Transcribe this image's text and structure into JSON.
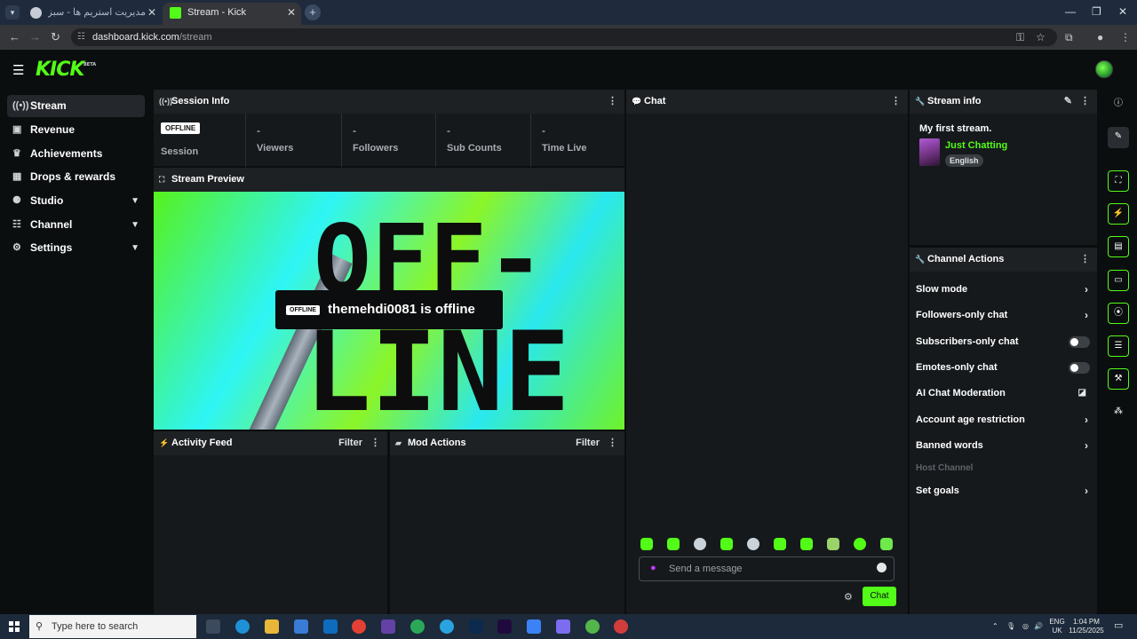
{
  "browser": {
    "tabs": [
      {
        "title": "مدیریت استریم ها - سبز استریم",
        "active": false
      },
      {
        "title": "Stream - Kick Dashboard",
        "active": true
      }
    ],
    "new_tab": "+",
    "url_host": "dashboard.kick.com",
    "url_path": "/stream"
  },
  "app": {
    "logo": "KICK",
    "logo_badge": "BETA"
  },
  "sidebar": {
    "items": [
      {
        "label": "Stream",
        "icon": "broadcast-icon",
        "active": true
      },
      {
        "label": "Revenue",
        "icon": "wallet-icon"
      },
      {
        "label": "Achievements",
        "icon": "trophy-icon"
      },
      {
        "label": "Drops & rewards",
        "icon": "gift-icon"
      },
      {
        "label": "Studio",
        "icon": "studio-icon",
        "expandable": true
      },
      {
        "label": "Channel",
        "icon": "channel-icon",
        "expandable": true
      },
      {
        "label": "Settings",
        "icon": "gear-icon",
        "expandable": true
      }
    ]
  },
  "session": {
    "title": "Session Info",
    "status_badge": "OFFLINE",
    "stats": [
      {
        "label": "Session",
        "value": ""
      },
      {
        "label": "Viewers",
        "value": "-"
      },
      {
        "label": "Followers",
        "value": "-"
      },
      {
        "label": "Sub Counts",
        "value": "-"
      },
      {
        "label": "Time Live",
        "value": "-"
      }
    ]
  },
  "preview": {
    "title": "Stream Preview",
    "big_text_1": "OFF-",
    "big_text_2": "LINE",
    "badge": "OFFLINE",
    "message": "themehdi0081 is offline"
  },
  "activity": {
    "title": "Activity Feed",
    "filter": "Filter"
  },
  "mod_actions": {
    "title": "Mod Actions",
    "filter": "Filter"
  },
  "chat": {
    "title": "Chat",
    "placeholder": "Send a message",
    "send_label": "Chat"
  },
  "stream_info": {
    "title": "Stream info",
    "stream_title": "My first stream.",
    "category": "Just Chatting",
    "language": "English"
  },
  "channel_actions": {
    "title": "Channel Actions",
    "items": [
      {
        "label": "Slow mode",
        "control": "chevron"
      },
      {
        "label": "Followers-only chat",
        "control": "chevron"
      },
      {
        "label": "Subscribers-only chat",
        "control": "toggle",
        "on": false
      },
      {
        "label": "Emotes-only chat",
        "control": "toggle",
        "on": false
      },
      {
        "label": "AI Chat Moderation",
        "control": "chart"
      },
      {
        "label": "Account age restriction",
        "control": "chevron"
      },
      {
        "label": "Banned words",
        "control": "chevron"
      },
      {
        "label": "Host Channel",
        "control": "none",
        "disabled": true
      },
      {
        "label": "Set goals",
        "control": "chevron"
      }
    ]
  },
  "taskbar": {
    "search_placeholder": "Type here to search",
    "lang_top": "ENG",
    "lang_bottom": "UK",
    "time": "1:04 PM",
    "date": "11/25/2025"
  },
  "colors": {
    "accent": "#53fc18",
    "background": "#0b0e0f",
    "panel": "#16191c"
  }
}
